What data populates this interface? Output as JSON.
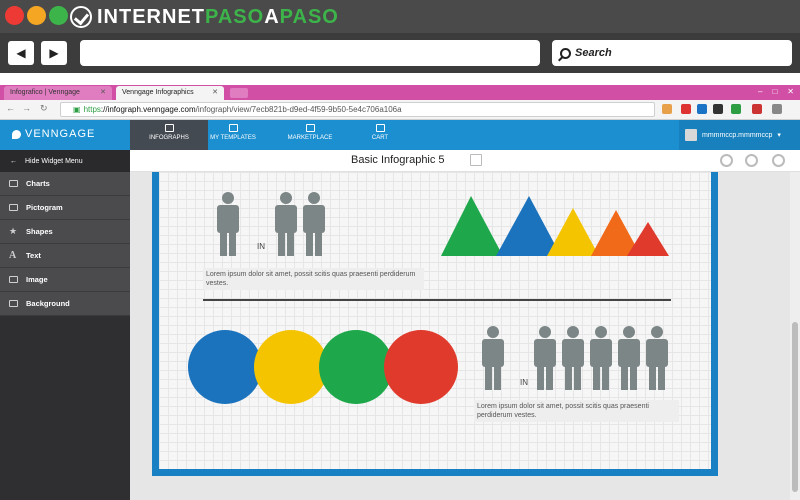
{
  "outer": {
    "brand_prefix": "INTERNET",
    "brand_accent": "PASO",
    "brand_mid": "A",
    "brand_suffix": "PASO",
    "nav_back": "◀",
    "nav_forward": "▶",
    "search_label": "Search"
  },
  "browser": {
    "tabs": [
      {
        "label": "Infografico | Venngage"
      },
      {
        "label": "Venngage Infographics"
      }
    ],
    "url_scheme": "https",
    "url_host": "://infograph.venngage.com",
    "url_path": "/infograph/view/7ecb821b-d9ed-4f59-9b50-5e4c706a106a"
  },
  "app": {
    "logo": "VENNGAGE",
    "nav_tabs": [
      {
        "label": "INFOGRAPHS",
        "active": true
      },
      {
        "label": "MY TEMPLATES",
        "active": false
      },
      {
        "label": "MARKETPLACE",
        "active": false
      },
      {
        "label": "CART",
        "active": false
      }
    ],
    "user_name": "mmmmccp.mmmmccp",
    "doc_title": "Basic Infographic 5"
  },
  "sidebar": {
    "hide_label": "Hide Widget Menu",
    "items": [
      {
        "label": "Charts",
        "icon": "chart-icon"
      },
      {
        "label": "Pictogram",
        "icon": "pictogram-icon"
      },
      {
        "label": "Shapes",
        "icon": "shapes-icon"
      },
      {
        "label": "Text",
        "icon": "text-icon"
      },
      {
        "label": "Image",
        "icon": "image-icon"
      },
      {
        "label": "Background",
        "icon": "background-icon"
      }
    ]
  },
  "infographic": {
    "in_label_1": "IN",
    "in_label_2": "IN",
    "lorem_1": "Lorem ipsum dolor sit amet, possit scitis quas praesenti perdiderum vestes.",
    "lorem_2": "Lorem ipsum dolor sit amet, possit scitis quas praesenti perdiderum vestes.",
    "triangle_colors": [
      "#1ea84b",
      "#1b73bd",
      "#f5c400",
      "#f06a1a",
      "#e03a2c"
    ],
    "circle_colors": [
      "#1b73bd",
      "#f5c400",
      "#1ea84b",
      "#e03a2c"
    ],
    "person_color": "#7d8686",
    "frame_color": "#1a80c4"
  }
}
